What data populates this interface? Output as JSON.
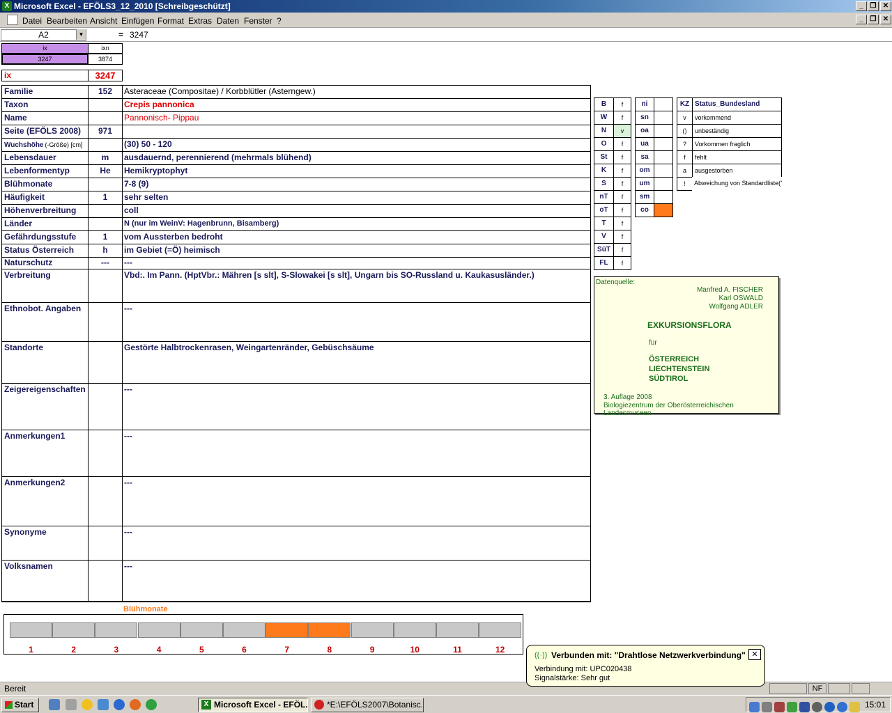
{
  "window": {
    "title": "Microsoft Excel - EFÖLS3_12_2010  [Schreibgeschützt]",
    "excel_icon": "X",
    "min_label": "_",
    "max_label": "❐",
    "close_label": "✕"
  },
  "menu": [
    "Datei",
    "Bearbeiten",
    "Ansicht",
    "Einfügen",
    "Format",
    "Extras",
    "Daten",
    "Fenster",
    "?"
  ],
  "formula": {
    "namebox": "A2",
    "equals": "=",
    "value": "3247"
  },
  "top": {
    "ix_header": "ix",
    "ixn_header": "ixn",
    "ix_val": "3247",
    "ixn_val": "3874",
    "ix_label": "ix",
    "ix_main": "3247"
  },
  "rows": [
    {
      "label": "Familie",
      "num": "152",
      "value": "Asteraceae (Compositae)  /  Korbblütler (Asterngew.)"
    },
    {
      "label": "Taxon",
      "num": "",
      "value": "Crepis pannonica"
    },
    {
      "label": "Name",
      "num": "",
      "value": "Pannonisch- Pippau"
    },
    {
      "label": "Seite (EFÖLS 2008)",
      "num": "971",
      "value": ""
    },
    {
      "label": "Wuchshöhe",
      "label_small": "(-Größe) [cm]",
      "num": "",
      "value": "(30) 50 - 120"
    },
    {
      "label": "Lebensdauer",
      "num": "m",
      "value": "ausdauernd, perennierend (mehrmals blühend)"
    },
    {
      "label": "Lebenformentyp",
      "num": "He",
      "value": "Hemikryptophyt"
    },
    {
      "label": "Blühmonate",
      "num": "",
      "value": "7-8 (9)"
    },
    {
      "label": "Häufigkeit",
      "num": "1",
      "value": "sehr selten"
    },
    {
      "label": "Höhenverbreitung",
      "num": "",
      "value": "coll"
    },
    {
      "label": "Länder",
      "num": "",
      "value": "N (nur im WeinV: Hagenbrunn, Bisamberg)"
    },
    {
      "label": "Gefährdungsstufe",
      "num": "1",
      "value": "vom Aussterben bedroht"
    },
    {
      "label": "Status Österreich",
      "num": "h",
      "value": "im Gebiet (=Ö) heimisch"
    },
    {
      "label": "Naturschutz",
      "num": "---",
      "value": "---"
    },
    {
      "label": "Verbreitung",
      "num": "",
      "value": "Vbd:. Im Pann.  (HptVbr.: Mähren [s slt], S-Slowakei [s slt], Ungarn bis SO-Russland u. Kaukasusländer.)"
    },
    {
      "label": "Ethnobot. Angaben",
      "num": "",
      "value": "---"
    },
    {
      "label": "Standorte",
      "num": "",
      "value": "Gestörte Halbtrockenrasen, Weingartenränder, Gebüschsäume"
    },
    {
      "label": "Zeigereigenschaften",
      "num": "",
      "value": "---"
    },
    {
      "label": "Anmerkungen1",
      "num": "",
      "value": "---"
    },
    {
      "label": "Anmerkungen2",
      "num": "",
      "value": "---"
    },
    {
      "label": "Synonyme",
      "num": "",
      "value": "---"
    },
    {
      "label": "Volksnamen",
      "num": "",
      "value": "---"
    }
  ],
  "states": [
    {
      "code": "B",
      "val": "f"
    },
    {
      "code": "W",
      "val": "f"
    },
    {
      "code": "N",
      "val": "v"
    },
    {
      "code": "O",
      "val": "f"
    },
    {
      "code": "St",
      "val": "f"
    },
    {
      "code": "K",
      "val": "f"
    },
    {
      "code": "S",
      "val": "f"
    },
    {
      "code": "nT",
      "val": "f"
    },
    {
      "code": "oT",
      "val": "f"
    },
    {
      "code": "T",
      "val": "f"
    },
    {
      "code": "V",
      "val": "f"
    },
    {
      "code": "SüT",
      "val": "f"
    },
    {
      "code": "FL",
      "val": "f"
    }
  ],
  "altitude": [
    "ni",
    "sn",
    "oa",
    "ua",
    "sa",
    "om",
    "um",
    "sm",
    "co"
  ],
  "legend": {
    "header_kz": "KZ",
    "header_status": "Status_Bundesland",
    "items": [
      {
        "kz": "v",
        "text": "vorkommend"
      },
      {
        "kz": "()",
        "text": "unbeständig"
      },
      {
        "kz": "?",
        "text": "Vorkommen fraglich"
      },
      {
        "kz": "f",
        "text": "fehlt"
      },
      {
        "kz": "a",
        "text": "ausgestorben"
      },
      {
        "kz": "!",
        "text": "Abweichung von Standardliste(?)"
      }
    ]
  },
  "source": {
    "label": "Datenquelle:",
    "author1": "Manfred A. FISCHER",
    "author2": "Karl OSWALD",
    "author3": "Wolfgang ADLER",
    "title": "EXKURSIONSFLORA",
    "fuer": "für",
    "country1": "ÖSTERREICH",
    "country2": "LIECHTENSTEIN",
    "country3": "SÜDTIROL",
    "edition": "3. Auflage 2008",
    "publisher": "Biologiezentrum der Oberösterreichischen Landesmuseen"
  },
  "bloom": {
    "title": "Blühmonate",
    "months": [
      "1",
      "2",
      "3",
      "4",
      "5",
      "6",
      "7",
      "8",
      "9",
      "10",
      "11",
      "12"
    ],
    "active": [
      7,
      8
    ]
  },
  "status": {
    "text": "Bereit",
    "nf": "NF"
  },
  "balloon": {
    "title": "Verbunden mit: \"Drahtlose Netzwerkverbindung\"",
    "line1": "Verbindung mit: UPC020438",
    "line2": "Signalstärke: Sehr gut",
    "close": "✕"
  },
  "taskbar": {
    "start": "Start",
    "task1": "Microsoft Excel - EFÖL...",
    "task2": "*E:\\EFÖLS2007\\Botanisc...",
    "clock": "15:01"
  },
  "colors": {
    "orange": "#ff7a1a",
    "purple": "#c58fe8",
    "green_cell": "#d9f2d9",
    "red": "#e00000",
    "source_bg": "#ffffe6"
  }
}
